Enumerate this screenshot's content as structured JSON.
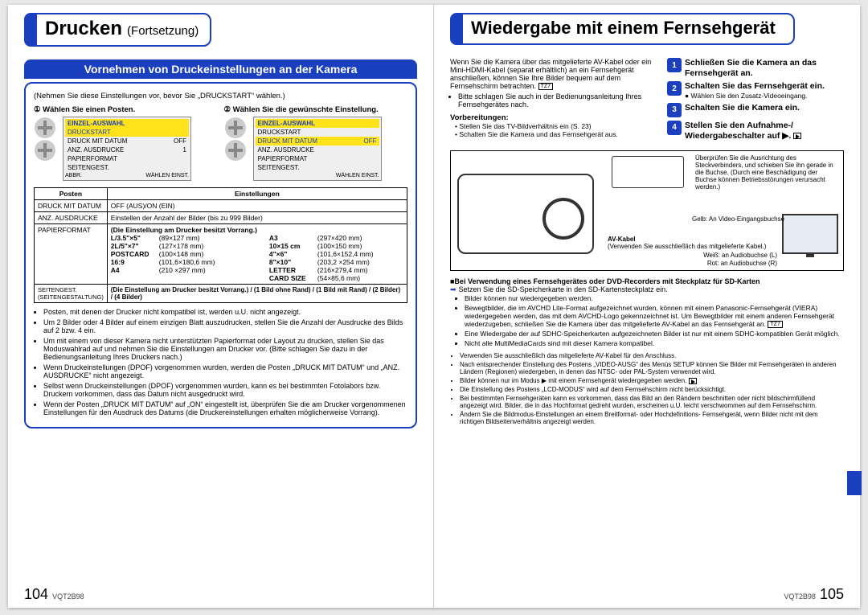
{
  "left": {
    "title": "Drucken",
    "subtitle": "(Fortsetzung)",
    "section_bar": "Vornehmen von Druckeinstellungen an der Kamera",
    "note_top": "(Nehmen Sie diese Einstellungen vor, bevor Sie „DRUCKSTART“ wählen.)",
    "step1_title": "① Wählen Sie einen Posten.",
    "step2_title": "② Wählen Sie die gewünschte Einstellung.",
    "menu_head": "EINZEL-AUSWAHL",
    "menu1": [
      "DRUCKSTART",
      "DRUCK MIT DATUM",
      "ANZ. AUSDRUCKE",
      "PAPIERFORMAT",
      "SEITENGEST."
    ],
    "menu1_vals": [
      "",
      "OFF",
      "1",
      "",
      ""
    ],
    "menu1_foot_l": "ABBR.",
    "menu1_foot_r": "WÄHLEN   EINST.",
    "menu2_items": [
      "DRUCKSTART",
      "DRUCK MIT DATUM",
      "ANZ. AUSDRUCKE",
      "PAPIERFORMAT",
      "SEITENGEST."
    ],
    "menu2_sel": "OFF",
    "menu2_foot": "WÄHLEN   EINST.",
    "table_head_posten": "Posten",
    "table_head_einst": "Einstellungen",
    "row1_posten": "DRUCK MIT DATUM",
    "row1_einst": "OFF (AUS)/ON (EIN)",
    "row2_posten": "ANZ. AUSDRUCKE",
    "row2_einst": "Einstellen der Anzahl der Bilder (bis zu 999 Bilder)",
    "row3_posten": "PAPIERFORMAT",
    "row3_lead": "(Die Einstellung am Drucker besitzt Vorrang.)",
    "sizes_left": [
      [
        "L/3.5\"×5\"",
        "(89×127 mm)"
      ],
      [
        "2L/5\"×7\"",
        "(127×178 mm)"
      ],
      [
        "POSTCARD",
        "(100×148 mm)"
      ],
      [
        "16:9",
        "(101,6×180,6 mm)"
      ],
      [
        "A4",
        "(210 ×297 mm)"
      ]
    ],
    "sizes_right": [
      [
        "A3",
        "(297×420 mm)"
      ],
      [
        "10×15 cm",
        "(100×150 mm)"
      ],
      [
        "4\"×6\"",
        "(101,6×152,4 mm)"
      ],
      [
        "8\"×10\"",
        "(203,2 ×254 mm)"
      ],
      [
        "LETTER",
        "(216×279,4 mm)"
      ],
      [
        "CARD SIZE",
        "(54×85,6 mm)"
      ]
    ],
    "row4_posten": "SEITENGEST. (SEITENGESTALTUNG)",
    "row4_einst": "(Die Einstellung am Drucker besitzt Vorrang.) / (1 Bild ohne Rand) / (1 Bild mit Rand) / (2 Bilder) / (4 Bilder)",
    "bul": [
      "Posten, mit denen der Drucker nicht kompatibel ist, werden u.U. nicht angezeigt.",
      "Um 2 Bilder oder 4 Bilder auf einem einzigen Blatt auszudrucken, stellen Sie die Anzahl der Ausdrucke des Bilds auf 2 bzw. 4 ein.",
      "Um mit einem von dieser Kamera nicht unterstützten Papierformat oder Layout zu drucken, stellen Sie das Moduswahlrad auf und nehmen Sie die Einstellungen am Drucker vor. (Bitte schlagen Sie dazu in der Bedienungsanleitung Ihres Druckers nach.)",
      "Wenn Druckeinstellungen (DPOF) vorgenommen wurden, werden die Posten „DRUCK MIT DATUM“ und „ANZ. AUSDRUCKE“ nicht angezeigt.",
      "Selbst wenn Druckeinstellungen (DPOF) vorgenommen wurden, kann es bei bestimmten Fotolabors bzw. Druckern vorkommen, dass das Datum nicht ausgedruckt wird.",
      "Wenn der Posten „DRUCK MIT DATUM“ auf „ON“ eingestellt ist, überprüfen Sie die am Drucker vorgenommenen Einstellungen für den Ausdruck des Datums (die Druckereinstellungen erhalten möglicherweise Vorrang)."
    ],
    "pagenum": "104",
    "pagecode": "VQT2B98"
  },
  "right": {
    "title": "Wiedergabe mit einem Fernsehgerät",
    "intro1": "Wenn Sie die Kamera über das mitgelieferte AV-Kabel oder ein Mini-HDMI-Kabel (separat erhältlich) an ein Fernsehgerät anschließen, können Sie Ihre Bilder bequem auf dem Fernsehschirm betrachten.",
    "intro2": "Bitte schlagen Sie auch in der Bedienungsanleitung Ihres Fernsehgerätes nach.",
    "prep_title": "Vorbereitungen:",
    "prep_items": [
      "Stellen Sie das TV-Bildverhältnis ein (S. 23)",
      "Schalten Sie die Kamera und das Fernsehgerät aus."
    ],
    "steps": [
      {
        "n": "1",
        "t": "Schließen Sie die Kamera an das Fernsehgerät an."
      },
      {
        "n": "2",
        "t": "Schalten Sie das Fernsehgerät ein.",
        "s": "Wählen Sie den Zusatz-Videoeingang."
      },
      {
        "n": "3",
        "t": "Schalten Sie die Kamera ein."
      },
      {
        "n": "4",
        "t": "Stellen Sie den Aufnahme-/ Wiedergabeschalter auf ▶."
      }
    ],
    "diag": {
      "check": "Überprüfen Sie die Ausrichtung des Steckverbinders, und schieben Sie ihn gerade in die Buchse. (Durch eine Beschädigung der Buchse können Betriebsstörungen verursacht werden.)",
      "yellow": "Gelb: An Video-Eingangsbuchse",
      "av": "AV-Kabel",
      "av_note": "(Verwenden Sie ausschließlich das mitgelieferte Kabel.)",
      "white": "Weiß: an Audiobuchse (L)",
      "red": "Rot: an Audiobuchse (R)"
    },
    "sd_head": "■Bei Verwendung eines Fernsehgerätes oder DVD-Recorders mit Steckplatz für SD-Karten",
    "sd_intro": "Setzen Sie die SD-Speicherkarte in den SD-Kartensteckplatz ein.",
    "sd_items": [
      "Bilder können nur wiedergegeben werden.",
      "Bewegtbilder, die im AVCHD Lite-Format aufgezeichnet wurden, können mit einem Panasonic-Fernsehgerät (VIERA) wiedergegeben werden, das mit dem AVCHD-Logo gekennzeichnet ist. Um Bewegtbilder mit einem anderen Fernsehgerät wiederzugeben, schließen Sie die Kamera über das mitgelieferte AV-Kabel an das Fernsehgerät an.",
      "Eine Wiedergabe der auf SDHC-Speicherkarten aufgezeichneten Bilder ist nur mit einem SDHC-kompatiblen Gerät möglich.",
      "Nicht alle MultiMediaCards sind mit dieser Kamera kompatibel."
    ],
    "fine": [
      "Verwenden Sie ausschließlich das mitgelieferte AV-Kabel für den Anschluss.",
      "Nach entsprechender Einstellung des Postens „VIDEO-AUSG“ des Menüs SETUP können Sie Bilder mit Fernsehgeräten in anderen Ländern (Regionen) wiedergeben, in denen das NTSC- oder PAL-System verwendet wird.",
      "Bilder können nur im Modus ▶ mit einem Fernsehgerät wiedergegeben werden.",
      "Die Einstellung des Postens „LCD-MODUS“ wird auf dem Fernsehschirm nicht berücksichtigt.",
      "Bei bestimmten Fernsehgeräten kann es vorkommen, dass das Bild an den Rändern beschnitten oder nicht bildschirmfüllend angezeigt wird. Bilder, die in das Hochformat gedreht wurden, erscheinen u.U. leicht verschwommen auf dem Fernsehschirm.",
      "Ändern Sie die Bildmodus-Einstellungen an einem Breitformat- oder Hochdefinitions- Fernsehgerät, wenn Bilder nicht mit dem richtigen Bildseitenverhältnis angezeigt werden."
    ],
    "tz7": "TZ7",
    "pagenum": "105",
    "pagecode": "VQT2B98"
  }
}
